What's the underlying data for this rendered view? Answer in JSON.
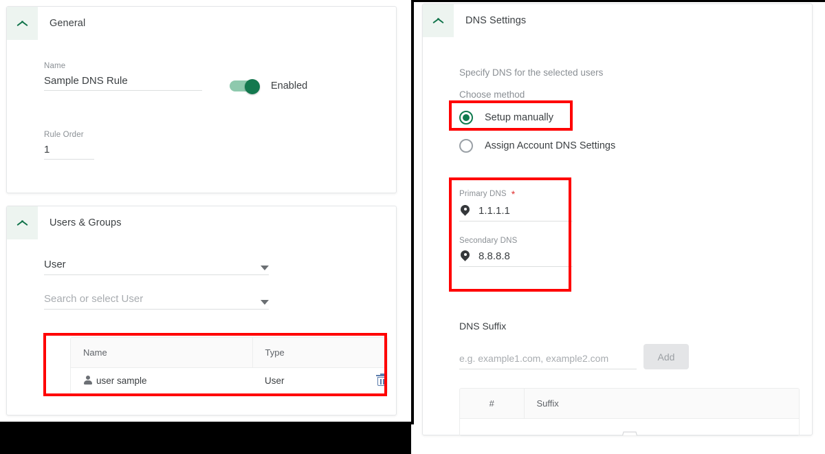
{
  "left_panel": {
    "general_card": {
      "title": "General",
      "collapse_icon": "chevron-up-icon",
      "name_label": "Name",
      "name_value": "Sample DNS Rule",
      "toggle_label": "Enabled",
      "toggle_state": "on",
      "rule_order_label": "Rule Order",
      "rule_order_value": "1"
    },
    "users_groups_card": {
      "title": "Users & Groups",
      "collapse_icon": "chevron-up-icon",
      "type_select_value": "User",
      "search_select_placeholder": "Search or select User",
      "table": {
        "columns": [
          "Name",
          "Type"
        ],
        "rows": [
          {
            "name": "user sample",
            "type": "User",
            "delete_icon": "trash-icon"
          }
        ]
      }
    }
  },
  "right_panel": {
    "dns_card": {
      "title": "DNS Settings",
      "collapse_icon": "chevron-up-icon",
      "description": "Specify DNS for the selected users",
      "method_label": "Choose method",
      "methods": [
        {
          "label": "Setup manually",
          "selected": true
        },
        {
          "label": "Assign Account DNS Settings",
          "selected": false
        }
      ],
      "primary_dns_label": "Primary DNS",
      "primary_dns_required": "*",
      "primary_dns_value": "1.1.1.1",
      "primary_dns_icon": "location-pin-icon",
      "secondary_dns_label": "Secondary DNS",
      "secondary_dns_value": "8.8.8.8",
      "secondary_dns_icon": "location-pin-icon",
      "suffix_label": "DNS Suffix",
      "suffix_placeholder": "e.g. example1.com, example2.com",
      "suffix_input_value": "",
      "add_button_label": "Add",
      "suffix_table": {
        "columns": [
          "#",
          "Suffix"
        ],
        "rows": []
      }
    }
  },
  "annotations": {
    "highlight_color": "#ff0000",
    "boxes": [
      "users-table-highlight",
      "setup-manually-highlight",
      "dns-fields-highlight"
    ]
  },
  "theme": {
    "accent_green": "#0f7a4e",
    "header_tint": "#edf4f0",
    "text_primary": "#3c4043",
    "text_muted": "#8a8f94",
    "trash_blue": "#5b7cab"
  }
}
